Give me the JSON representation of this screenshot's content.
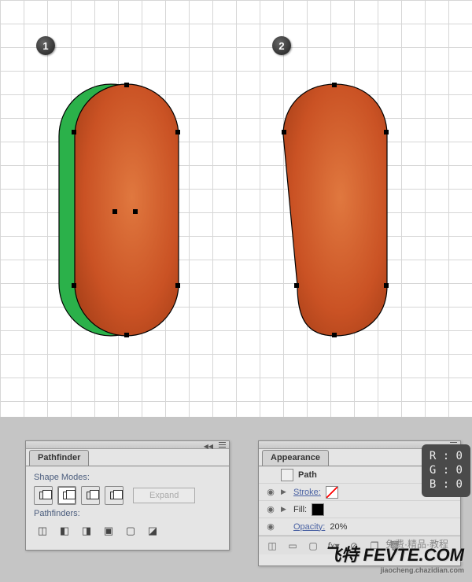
{
  "badges": {
    "one": "1",
    "two": "2"
  },
  "pathfinder": {
    "title": "Pathfinder",
    "shape_modes_label": "Shape Modes:",
    "expand_label": "Expand",
    "pathfinders_label": "Pathfinders:"
  },
  "appearance": {
    "title": "Appearance",
    "object_label": "Path",
    "stroke_label": "Stroke:",
    "fill_label": "Fill:",
    "opacity_label": "Opacity:",
    "opacity_value": "20%"
  },
  "rgb": {
    "r": "R : 0",
    "g": "G : 0",
    "b": "B : 0"
  },
  "watermark": {
    "main": "飞特 FEVTE.COM",
    "sub": "jiaocheng.chazidian.com",
    "extra": "免费·精品·教程"
  }
}
